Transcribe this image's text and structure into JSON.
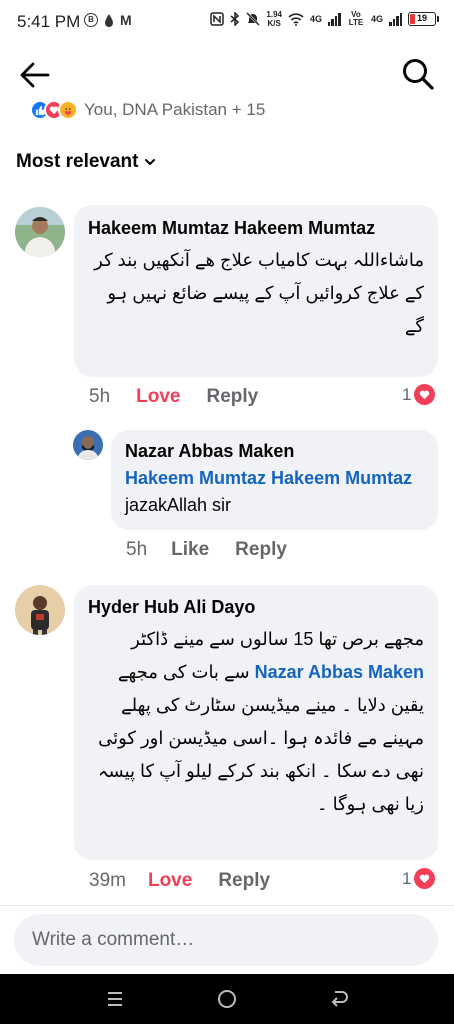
{
  "status": {
    "time": "5:41 PM",
    "speed_value": "1.94",
    "speed_unit": "K/S",
    "net1": "4G",
    "net2": "Vo LTE",
    "net3": "4G",
    "battery": "19"
  },
  "header": {
    "reactions_text": "You, DNA Pakistan + 15",
    "sort_label": "Most relevant"
  },
  "comments": [
    {
      "author": "Hakeem Mumtaz Hakeem Mumtaz",
      "text": "ماشاءاللہ بہت کامیاب علاج ھے آنکھیں بند کر کے علاج کروائیں آپ کے پیسے ضائع نہیں ہو گے",
      "time": "5h",
      "reaction_label": "Love",
      "reply_label": "Reply",
      "reaction_count": "1"
    },
    {
      "author": "Nazar Abbas Maken",
      "mention": "Hakeem Mumtaz Hakeem Mumtaz",
      "text": "jazakAllah sir",
      "time": "5h",
      "reaction_label": "Like",
      "reply_label": "Reply"
    },
    {
      "author": "Hyder Hub Ali Dayo",
      "text_before": "مجھے برص تھا 15 سالوں سے مینے ڈاکٹر",
      "mention": "Nazar Abbas Maken",
      "text_after": "سے بات کی مجھے یقین دلایا ۔ مینے میڈیسن سٹارٹ کی پھلے مہینے مے فائدہ ہوا ۔اسی میڈیسن اور کوئی نھی دے سکا ۔ انکھ بند کرکے لیلو آپ کا پیسہ زیا نھی ہوگا ۔",
      "time": "39m",
      "reaction_label": "Love",
      "reply_label": "Reply",
      "reaction_count": "1"
    }
  ],
  "composer": {
    "placeholder": "Write a comment…"
  },
  "colors": {
    "bubble": "#f0f2f5",
    "mention": "#1565c0",
    "love": "#f33e58",
    "muted": "#65676b"
  }
}
